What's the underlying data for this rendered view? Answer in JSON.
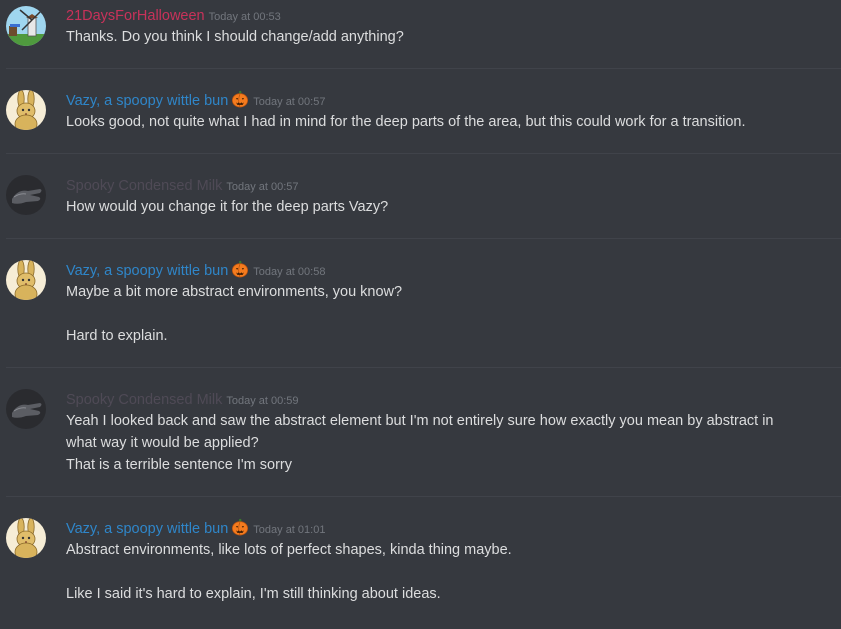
{
  "colors": {
    "user_21days": "#c8325a",
    "user_vazy": "#2f86c9",
    "user_spooky": "#4f4a56",
    "background": "#36393f",
    "text": "#dcddde",
    "timestamp": "#72767d"
  },
  "messages": [
    {
      "author": "21DaysForHalloween",
      "timestamp": "Today at 00:53",
      "avatar_icon": "windmill-avatar-icon",
      "lines": [
        "Thanks. Do you think I should change/add anything?"
      ]
    },
    {
      "author": "Vazy, a spoopy wittle bun",
      "timestamp": "Today at 00:57",
      "avatar_icon": "bunny-avatar-icon",
      "badge_icon": "pumpkin-icon",
      "lines": [
        "Looks good, not quite what I had in mind for the deep parts of the area, but this could work for a transition."
      ]
    },
    {
      "author": "Spooky Condensed Milk",
      "timestamp": "Today at 00:57",
      "avatar_icon": "dark-hand-avatar-icon",
      "lines": [
        "How would you change it for the deep parts Vazy?"
      ]
    },
    {
      "author": "Vazy, a spoopy wittle bun",
      "timestamp": "Today at 00:58",
      "avatar_icon": "bunny-avatar-icon",
      "badge_icon": "pumpkin-icon",
      "lines": [
        "Maybe a bit more abstract environments, you know?",
        "Hard to explain."
      ]
    },
    {
      "author": "Spooky Condensed Milk",
      "timestamp": "Today at 00:59",
      "avatar_icon": "dark-hand-avatar-icon",
      "lines": [
        "Yeah I looked back and saw the abstract element but I'm not entirely sure how exactly you mean by abstract in",
        "what way it would be applied?",
        "That is a terrible sentence I'm sorry"
      ]
    },
    {
      "author": "Vazy, a spoopy wittle bun",
      "timestamp": "Today at 01:01",
      "avatar_icon": "bunny-avatar-icon",
      "badge_icon": "pumpkin-icon",
      "lines": [
        "Abstract environments, like lots of perfect shapes, kinda thing maybe.",
        "Like I said it's hard to explain, I'm still thinking about ideas."
      ]
    }
  ]
}
